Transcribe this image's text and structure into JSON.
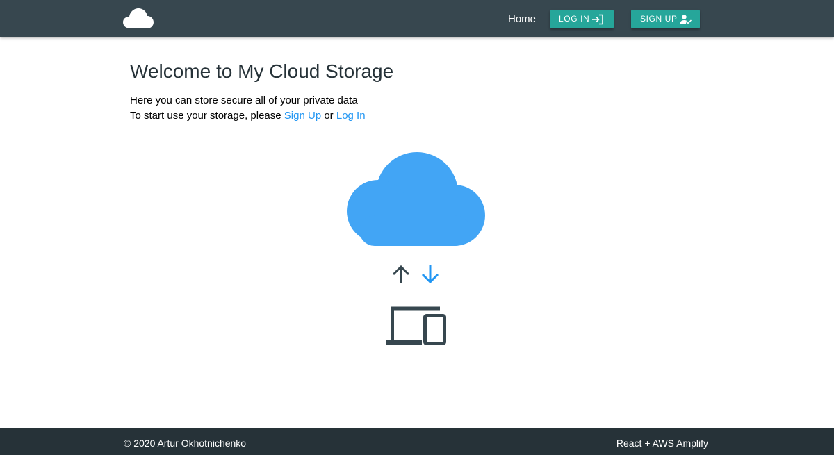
{
  "header": {
    "logo_icon": "cloud-icon",
    "home_label": "Home",
    "login_label": "LOG IN",
    "login_icon": "login-icon",
    "signup_label": "SIGN UP",
    "signup_icon": "person-check-icon"
  },
  "main": {
    "title": "Welcome to My Cloud Storage",
    "intro_line1": "Here you can store secure all of your private data",
    "intro_line2_prefix": "To start use your storage, please ",
    "signup_link": "Sign Up",
    "or_text": " or ",
    "login_link": "Log In",
    "illustration": {
      "cloud_icon": "cloud-icon",
      "upload_icon": "arrow-up-icon",
      "download_icon": "arrow-down-icon",
      "devices_icon": "devices-icon"
    }
  },
  "footer": {
    "copyright": "© 2020 Artur Okhotnichenko",
    "tech": "React + AWS Amplify"
  },
  "colors": {
    "navbar": "#37474f",
    "footer": "#263238",
    "accent_button": "#26a69a",
    "link": "#2196f3",
    "cloud": "#42a5f5",
    "dark_icon": "#37474f"
  }
}
